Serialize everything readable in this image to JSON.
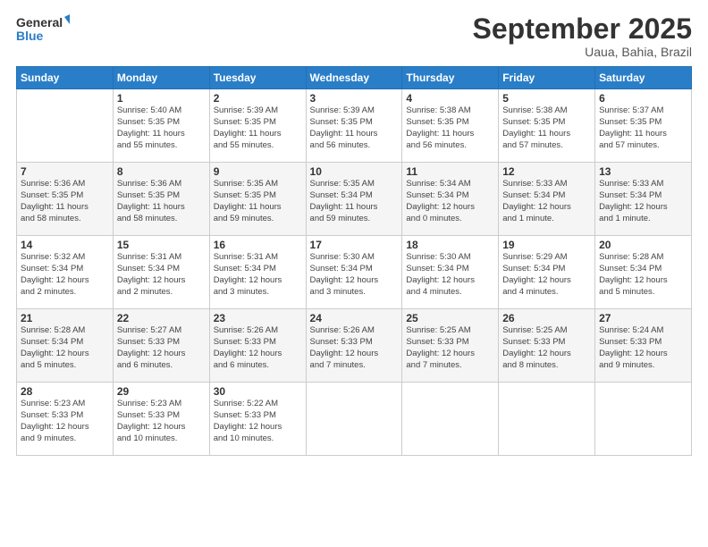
{
  "logo": {
    "line1": "General",
    "line2": "Blue"
  },
  "title": "September 2025",
  "subtitle": "Uaua, Bahia, Brazil",
  "weekdays": [
    "Sunday",
    "Monday",
    "Tuesday",
    "Wednesday",
    "Thursday",
    "Friday",
    "Saturday"
  ],
  "weeks": [
    [
      {
        "day": "",
        "detail": ""
      },
      {
        "day": "1",
        "detail": "Sunrise: 5:40 AM\nSunset: 5:35 PM\nDaylight: 11 hours\nand 55 minutes."
      },
      {
        "day": "2",
        "detail": "Sunrise: 5:39 AM\nSunset: 5:35 PM\nDaylight: 11 hours\nand 55 minutes."
      },
      {
        "day": "3",
        "detail": "Sunrise: 5:39 AM\nSunset: 5:35 PM\nDaylight: 11 hours\nand 56 minutes."
      },
      {
        "day": "4",
        "detail": "Sunrise: 5:38 AM\nSunset: 5:35 PM\nDaylight: 11 hours\nand 56 minutes."
      },
      {
        "day": "5",
        "detail": "Sunrise: 5:38 AM\nSunset: 5:35 PM\nDaylight: 11 hours\nand 57 minutes."
      },
      {
        "day": "6",
        "detail": "Sunrise: 5:37 AM\nSunset: 5:35 PM\nDaylight: 11 hours\nand 57 minutes."
      }
    ],
    [
      {
        "day": "7",
        "detail": "Sunrise: 5:36 AM\nSunset: 5:35 PM\nDaylight: 11 hours\nand 58 minutes."
      },
      {
        "day": "8",
        "detail": "Sunrise: 5:36 AM\nSunset: 5:35 PM\nDaylight: 11 hours\nand 58 minutes."
      },
      {
        "day": "9",
        "detail": "Sunrise: 5:35 AM\nSunset: 5:35 PM\nDaylight: 11 hours\nand 59 minutes."
      },
      {
        "day": "10",
        "detail": "Sunrise: 5:35 AM\nSunset: 5:34 PM\nDaylight: 11 hours\nand 59 minutes."
      },
      {
        "day": "11",
        "detail": "Sunrise: 5:34 AM\nSunset: 5:34 PM\nDaylight: 12 hours\nand 0 minutes."
      },
      {
        "day": "12",
        "detail": "Sunrise: 5:33 AM\nSunset: 5:34 PM\nDaylight: 12 hours\nand 1 minute."
      },
      {
        "day": "13",
        "detail": "Sunrise: 5:33 AM\nSunset: 5:34 PM\nDaylight: 12 hours\nand 1 minute."
      }
    ],
    [
      {
        "day": "14",
        "detail": "Sunrise: 5:32 AM\nSunset: 5:34 PM\nDaylight: 12 hours\nand 2 minutes."
      },
      {
        "day": "15",
        "detail": "Sunrise: 5:31 AM\nSunset: 5:34 PM\nDaylight: 12 hours\nand 2 minutes."
      },
      {
        "day": "16",
        "detail": "Sunrise: 5:31 AM\nSunset: 5:34 PM\nDaylight: 12 hours\nand 3 minutes."
      },
      {
        "day": "17",
        "detail": "Sunrise: 5:30 AM\nSunset: 5:34 PM\nDaylight: 12 hours\nand 3 minutes."
      },
      {
        "day": "18",
        "detail": "Sunrise: 5:30 AM\nSunset: 5:34 PM\nDaylight: 12 hours\nand 4 minutes."
      },
      {
        "day": "19",
        "detail": "Sunrise: 5:29 AM\nSunset: 5:34 PM\nDaylight: 12 hours\nand 4 minutes."
      },
      {
        "day": "20",
        "detail": "Sunrise: 5:28 AM\nSunset: 5:34 PM\nDaylight: 12 hours\nand 5 minutes."
      }
    ],
    [
      {
        "day": "21",
        "detail": "Sunrise: 5:28 AM\nSunset: 5:34 PM\nDaylight: 12 hours\nand 5 minutes."
      },
      {
        "day": "22",
        "detail": "Sunrise: 5:27 AM\nSunset: 5:33 PM\nDaylight: 12 hours\nand 6 minutes."
      },
      {
        "day": "23",
        "detail": "Sunrise: 5:26 AM\nSunset: 5:33 PM\nDaylight: 12 hours\nand 6 minutes."
      },
      {
        "day": "24",
        "detail": "Sunrise: 5:26 AM\nSunset: 5:33 PM\nDaylight: 12 hours\nand 7 minutes."
      },
      {
        "day": "25",
        "detail": "Sunrise: 5:25 AM\nSunset: 5:33 PM\nDaylight: 12 hours\nand 7 minutes."
      },
      {
        "day": "26",
        "detail": "Sunrise: 5:25 AM\nSunset: 5:33 PM\nDaylight: 12 hours\nand 8 minutes."
      },
      {
        "day": "27",
        "detail": "Sunrise: 5:24 AM\nSunset: 5:33 PM\nDaylight: 12 hours\nand 9 minutes."
      }
    ],
    [
      {
        "day": "28",
        "detail": "Sunrise: 5:23 AM\nSunset: 5:33 PM\nDaylight: 12 hours\nand 9 minutes."
      },
      {
        "day": "29",
        "detail": "Sunrise: 5:23 AM\nSunset: 5:33 PM\nDaylight: 12 hours\nand 10 minutes."
      },
      {
        "day": "30",
        "detail": "Sunrise: 5:22 AM\nSunset: 5:33 PM\nDaylight: 12 hours\nand 10 minutes."
      },
      {
        "day": "",
        "detail": ""
      },
      {
        "day": "",
        "detail": ""
      },
      {
        "day": "",
        "detail": ""
      },
      {
        "day": "",
        "detail": ""
      }
    ]
  ]
}
